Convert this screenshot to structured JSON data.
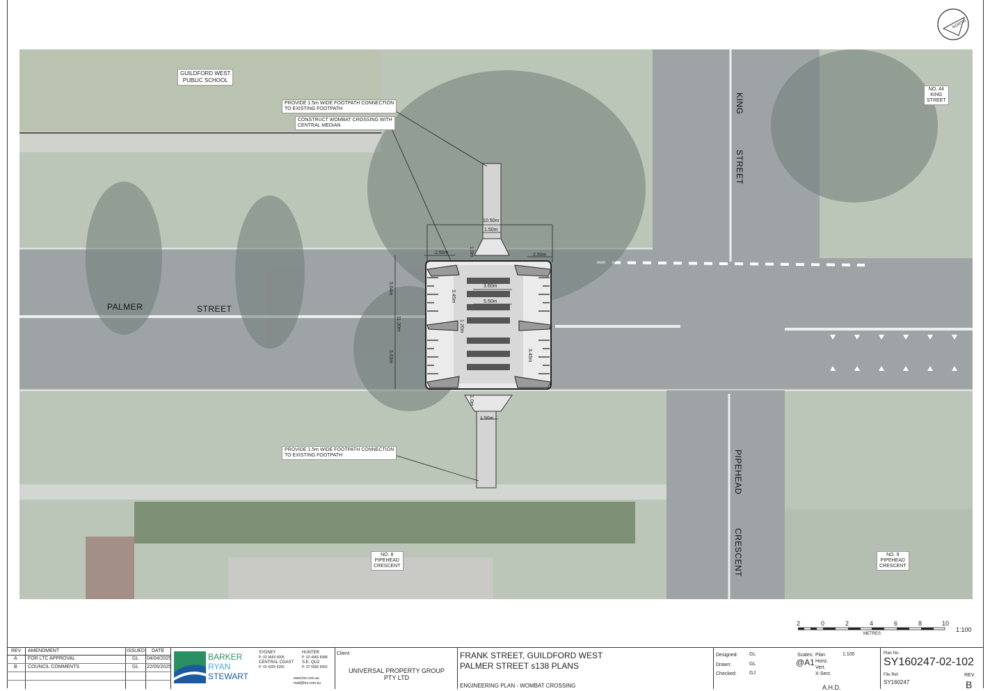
{
  "north_label": "NORTH",
  "labels": {
    "school": [
      "GUILDFORD WEST",
      "PUBLIC SCHOOL"
    ],
    "no44": [
      "NO. 44",
      "KING",
      "STREET"
    ],
    "no8": [
      "NO. 8",
      "PIPEHEAD",
      "CRESCENT"
    ],
    "no9": [
      "NO. 9",
      "PIPEHEAD",
      "CRESCENT"
    ],
    "note_footpath_top": [
      "PROVIDE 1.5m WIDE FOOTPATH CONNECTION",
      "TO EXISTING FOOTPATH"
    ],
    "note_wombat": [
      "CONSTRUCT WOMBAT CROSSING WITH",
      "CENTRAL MEDIAN"
    ],
    "note_footpath_bottom": [
      "PROVIDE 1.5m WIDE FOOTPATH CONNECTION",
      "TO EXISTING FOOTPATH"
    ]
  },
  "streets": {
    "palmer": "PALMER",
    "street": "STREET",
    "king": "KING",
    "king_street": "STREET",
    "pipehead": "PIPEHEAD",
    "crescent": "CRESCENT"
  },
  "dimensions": {
    "width_total": "10.50m",
    "footpath_top": "1.50m",
    "left_kerb": "2.50m",
    "right_kerb": "2.50m",
    "crossing_a": "3.60m",
    "crossing_b": "5.50m",
    "left_a": "3.45m",
    "right_a": "3.45m",
    "median": "1.20m",
    "vert_total": "11.30m",
    "vert_top": "5.64m",
    "vert_bottom": "5.63m",
    "footpath_bottom": "1.50m",
    "flare_top": "1.0m",
    "flare_bottom": "1.0m"
  },
  "scale": {
    "ticks": [
      "2",
      "0",
      "2",
      "4",
      "6",
      "8",
      "10"
    ],
    "unit": "METRES",
    "ratio": "1:100"
  },
  "title_block": {
    "rev_header": "REV",
    "amendment_header": "AMENDMENT",
    "issued_header": "ISSUED",
    "date_header": "DATE",
    "revisions": [
      {
        "rev": "A",
        "amendment": "FOR LTC APPROVAL",
        "issued": "GL",
        "date": "04/04/2025"
      },
      {
        "rev": "B",
        "amendment": "COUNCIL COMMENTS",
        "issued": "GL",
        "date": "22/05/2025"
      }
    ],
    "company": [
      "BARKER",
      "RYAN",
      "STEWART"
    ],
    "offices": {
      "sydney": "SYDNEY",
      "sydney_p": "P: 02 9659 0005",
      "central_coast": "CENTRAL COAST",
      "central_coast_p": "P: 02 4325 5255",
      "hunter": "HUNTER",
      "hunter_p": "P: 02 4966 8388",
      "seqld": "S.E. QLD",
      "seqld_p": "P: 07 5582 6555",
      "web": "www.brs.com.au",
      "email": "mail@brs.com.au"
    },
    "client_label": "Client:",
    "client": [
      "UNIVERSAL PROPERTY GROUP",
      "PTY LTD"
    ],
    "project": [
      "FRANK STREET, GUILDFORD WEST",
      "PALMER STREET s138 PLANS"
    ],
    "drawing": "ENGINEERING PLAN - WOMBAT CROSSING",
    "designed_label": "Designed:",
    "designed": "GL",
    "drawn_label": "Drawn:",
    "drawn": "GL",
    "checked_label": "Checked:",
    "checked": "GJ",
    "scales_label": "Scales:",
    "size": "@A1",
    "plan_label": "Plan",
    "plan_scale": "1:100",
    "horiz_label": "Horiz.",
    "vert_label": "Vert.",
    "xsect_label": "X-Sect.",
    "datum": "A.H.D.",
    "plan_no_label": "Plan No.",
    "plan_no": "SY160247-02-102",
    "file_ref_label": "File Ref.",
    "file_ref": "SY160247",
    "rev_label": "REV.",
    "rev": "B"
  }
}
